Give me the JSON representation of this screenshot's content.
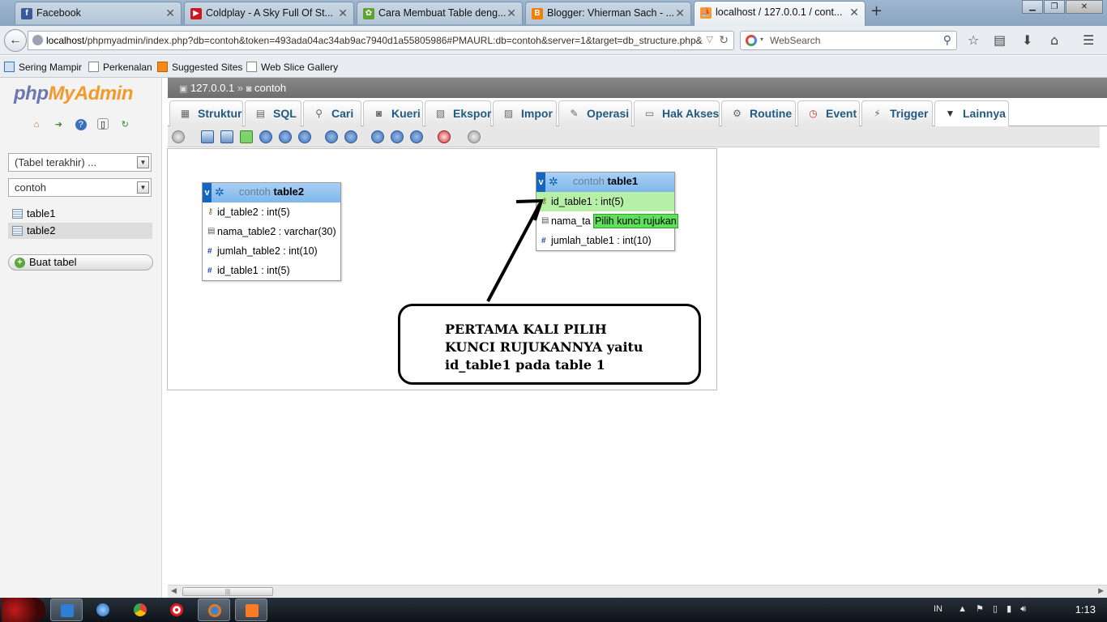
{
  "browser": {
    "tabs": [
      {
        "title": "Facebook",
        "favicon": "facebook-icon",
        "color": "#3b5998"
      },
      {
        "title": "Coldplay - A Sky Full Of St...",
        "favicon": "youtube-icon",
        "color": "#cc181e"
      },
      {
        "title": "Cara Membuat Table deng...",
        "favicon": "leaf-icon",
        "color": "#5fa231"
      },
      {
        "title": "Blogger: Vhierman Sach - ...",
        "favicon": "blogger-icon",
        "color": "#f57d00"
      },
      {
        "title": "localhost / 127.0.0.1 / cont...",
        "favicon": "phpmyadmin-icon",
        "color": "#f29a2e"
      }
    ],
    "url_host": "localhost",
    "url_rest": "/phpmyadmin/index.php?db=contoh&token=493ada04ac34ab9ac7940d1a55805986#PMAURL:db=contoh&server=1&target=db_structure.php&",
    "search_placeholder": "WebSearch",
    "bookmarks": [
      "Sering Mampir",
      "Perkenalan",
      "Suggested Sites",
      "Web Slice Gallery"
    ]
  },
  "sidebar": {
    "logo_a": "php",
    "logo_b": "MyAdmin",
    "recent_select": "(Tabel terakhir) ...",
    "db_select": "contoh",
    "tables": [
      "table1",
      "table2"
    ],
    "create_label": "Buat tabel"
  },
  "breadcrumb": {
    "server": "127.0.0.1",
    "sep": "»",
    "db": "contoh"
  },
  "menu": [
    "Struktur",
    "SQL",
    "Cari",
    "Kueri",
    "Ekspor",
    "Impor",
    "Operasi",
    "Hak Akses",
    "Routine",
    "Event",
    "Trigger",
    "Lainnya"
  ],
  "designer": {
    "table2": {
      "db": "contoh",
      "name": "table2",
      "columns": [
        "id_table2 : int(5)",
        "nama_table2 : varchar(30)",
        "jumlah_table2 : int(10)",
        "id_table1 : int(5)"
      ]
    },
    "table1": {
      "db": "contoh",
      "name": "table1",
      "columns": [
        "id_table1 : int(5)",
        "nama_ta",
        "jumlah_table1 : int(10)"
      ]
    },
    "tooltip": "Pilih kunci rujukan",
    "note": "PERTAMA KALI PILIH\nKUNCI RUJUKANNYA yaitu\nid_table1 pada table 1"
  },
  "taskbar": {
    "lang": "IN",
    "clock": "1:13"
  }
}
